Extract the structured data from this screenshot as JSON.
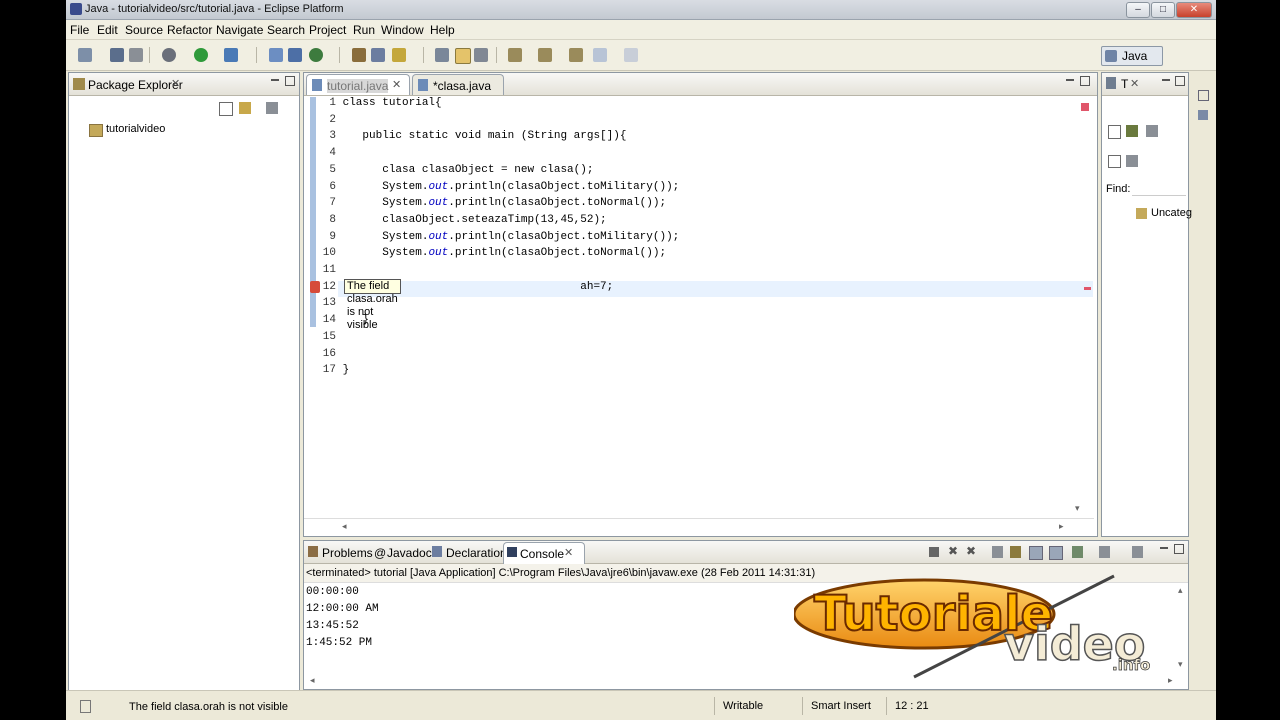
{
  "window": {
    "title": "Java - tutorialvideo/src/tutorial.java - Eclipse Platform",
    "controls": {
      "minimize": "–",
      "maximize": "□",
      "close": "✕"
    }
  },
  "menu": [
    "File",
    "Edit",
    "Source",
    "Refactor",
    "Navigate",
    "Search",
    "Project",
    "Run",
    "Window",
    "Help"
  ],
  "toolbar": {
    "perspective": "Java"
  },
  "package_explorer": {
    "title": "Package Explorer",
    "project": "tutorialvideo"
  },
  "editor": {
    "tabs": [
      {
        "label": "tutorial.java",
        "active": true
      },
      {
        "label": "*clasa.java",
        "active": false
      }
    ],
    "lines": [
      {
        "n": "1",
        "text": "class tutorial{"
      },
      {
        "n": "2",
        "text": ""
      },
      {
        "n": "3",
        "text": "   public static void main (String args[]){"
      },
      {
        "n": "4",
        "text": ""
      },
      {
        "n": "5",
        "text": "      clasa clasaObject = new clasa();"
      },
      {
        "n": "6",
        "pre": "      System.",
        "it": "out",
        "post": ".println(clasaObject.toMilitary());"
      },
      {
        "n": "7",
        "pre": "      System.",
        "it": "out",
        "post": ".println(clasaObject.toNormal());"
      },
      {
        "n": "8",
        "text": "      clasaObject.seteazaTimp(13,45,52);"
      },
      {
        "n": "9",
        "pre": "      System.",
        "it": "out",
        "post": ".println(clasaObject.toMilitary());"
      },
      {
        "n": "10",
        "pre": "      System.",
        "it": "out",
        "post": ".println(clasaObject.toNormal());"
      },
      {
        "n": "11",
        "text": ""
      },
      {
        "n": "12",
        "text": "                                    ah=7;"
      },
      {
        "n": "13",
        "text": ""
      },
      {
        "n": "14",
        "text": "   }"
      },
      {
        "n": "15",
        "text": ""
      },
      {
        "n": "16",
        "text": ""
      },
      {
        "n": "17",
        "text": "}"
      }
    ],
    "tooltip": "The field clasa.orah is not visible"
  },
  "outline": {
    "tab": "T",
    "find_label": "Find:",
    "item": "Uncateg"
  },
  "bottom_tabs": [
    "Problems",
    "Javadoc",
    "Declaration",
    "Console"
  ],
  "console": {
    "header": "<terminated> tutorial [Java Application] C:\\Program Files\\Java\\jre6\\bin\\javaw.exe (28 Feb 2011 14:31:31)",
    "output": [
      "00:00:00",
      "12:00:00 AM",
      "13:45:52",
      "1:45:52 PM"
    ]
  },
  "statusbar": {
    "message": "The field clasa.orah is not visible",
    "writable": "Writable",
    "insert_mode": "Smart Insert",
    "position": "12 : 21"
  },
  "watermark": {
    "line1": "Tutoriale",
    "line2": "video",
    "suffix": ".info"
  }
}
